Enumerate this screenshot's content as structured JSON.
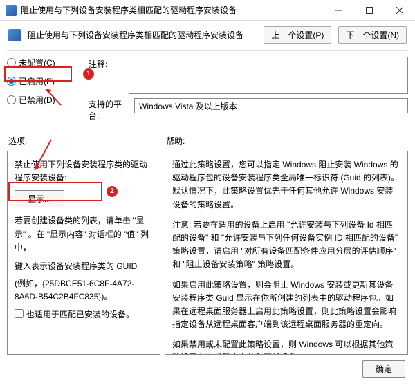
{
  "window": {
    "title": "阻止使用与下列设备安装程序类相匹配的驱动程序安装设备"
  },
  "header": {
    "title": "阻止使用与下列设备安装程序类相匹配的驱动程序安装设备",
    "prev_btn": "上一个设置(P)",
    "next_btn": "下一个设置(N)"
  },
  "config": {
    "not_configured": "未配置(C)",
    "enabled": "已启用(E)",
    "disabled": "已禁用(D)",
    "comment_label": "注释:",
    "platform_label": "支持的平台:",
    "platform_value": "Windows Vista 及以上版本",
    "selected": "enabled"
  },
  "badges": {
    "one": "1",
    "two": "2"
  },
  "sections": {
    "options_label": "选项:",
    "help_label": "帮助:"
  },
  "options_panel": {
    "line1": "禁止使用下列设备安装程序类的驱动程序安装设备:",
    "show_btn": "显示...",
    "line2": "若要创建设备类的列表，请单击 \"显示\" 。在 \"显示内容\" 对话框的 \"值\" 列中，",
    "line3": "键入表示设备安装程序类的 GUID",
    "line4": "(例如，{25DBCE51-6C8F-4A72-8A6D-B54C2B4FC835})。",
    "checkbox_label": "也适用于匹配已安装的设备。"
  },
  "help_panel": {
    "p1": "通过此策略设置，您可以指定 Windows 阻止安装 Windows 的驱动程序包的设备安装程序类全局唯一标识符 (Guid 的列表)。默认情况下，此策略设置优先于任何其他允许 Windows 安装设备的策略设置。",
    "p2": "注意: 若要在适用的设备上启用 \"允许安装与下列设备 Id 相匹配的设备\" 和 \"允许安装与下列任何设备实例 ID 相匹配的设备\" 策略设置，请启用 \"对所有设备匹配条件应用分层的评估顺序\" 和 \"阻止设备安装策略\" 策略设置。",
    "p3": "如果启用此策略设置，则会阻止 Windows 安装或更新其设备安装程序类 Guid 显示在你所创建的列表中的驱动程序包。如果在远程桌面服务器上启用此策略设置，则此策略设置会影响指定设备从远程桌面客户端到该远程桌面服务器的重定向。",
    "p4": "如果禁用或未配置此策略设置，则 Windows 可以根据其他策略设置允许或阻止安装和更新设备。"
  },
  "footer": {
    "ok": "确定"
  }
}
